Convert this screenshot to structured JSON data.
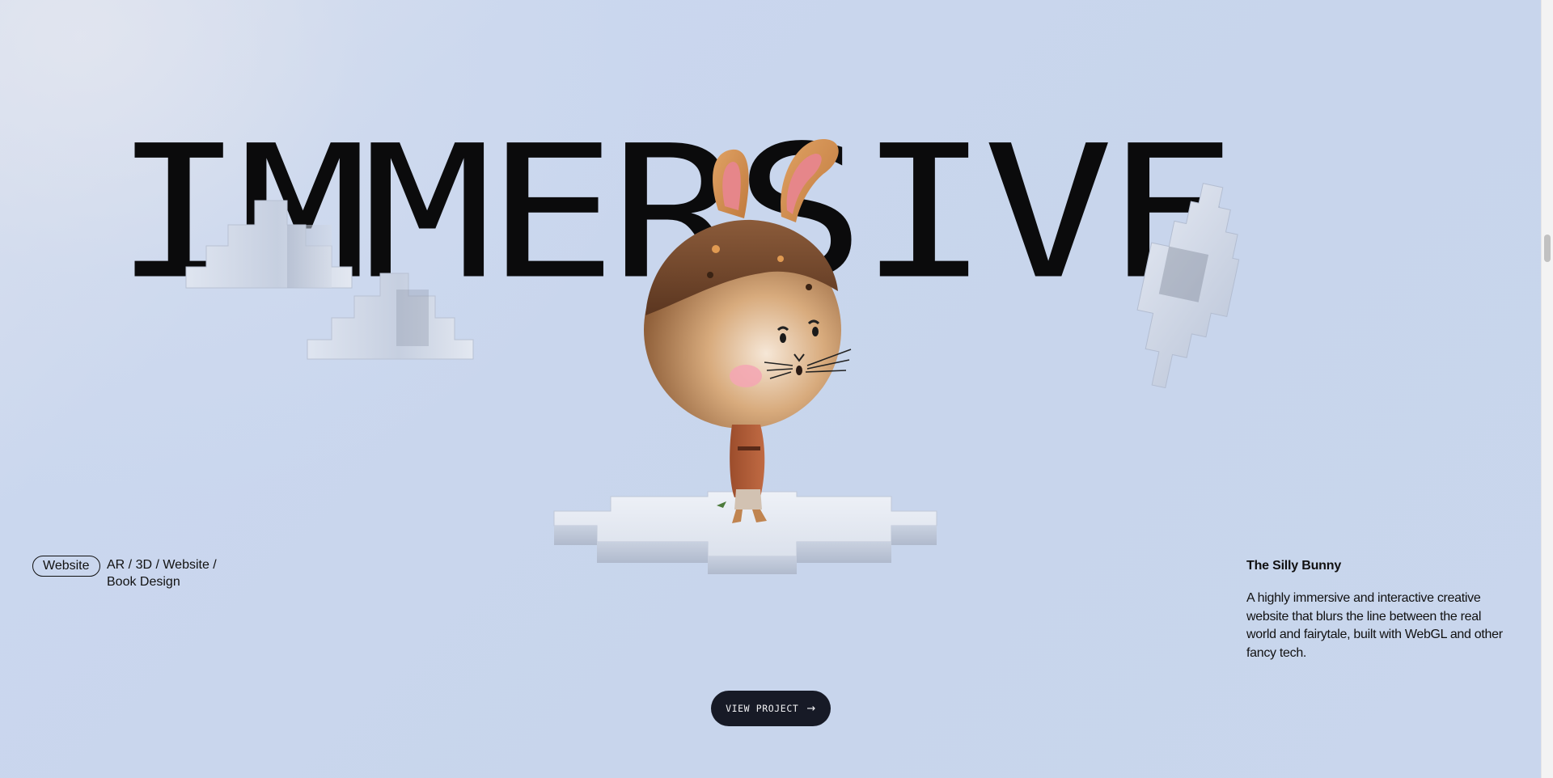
{
  "hero": {
    "headline": "IMMERSIVE"
  },
  "meta": {
    "type_tag": "Website",
    "categories": "AR / 3D / Website / Book Design"
  },
  "project": {
    "title": "The Silly Bunny",
    "description": "A highly immersive and interactive creative website that blurs the line between the real world and fairytale, built with WebGL and other fancy tech."
  },
  "cta": {
    "label": "VIEW PROJECT",
    "icon": "arrow-right-icon"
  },
  "colors": {
    "background": "#c9d6ed",
    "text": "#0b0b0c",
    "button": "#171a26",
    "button_text": "#f2f2f4"
  }
}
